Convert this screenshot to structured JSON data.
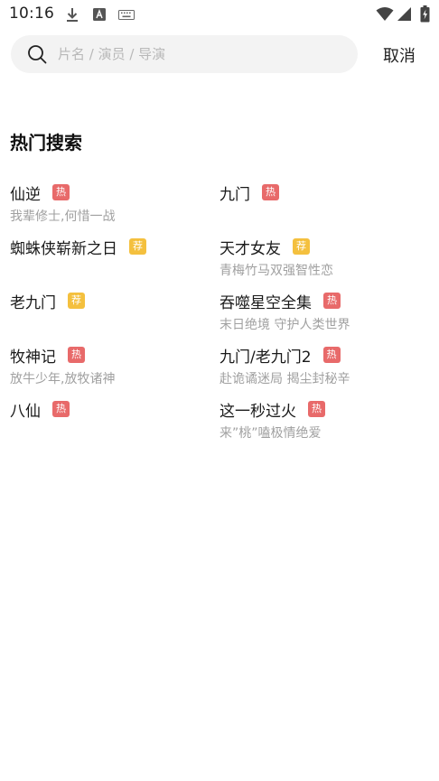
{
  "status_bar": {
    "time": "10:16"
  },
  "search": {
    "placeholder": "片名 / 演员 / 导演",
    "value": "",
    "cancel_label": "取消"
  },
  "hot_search": {
    "title": "热门搜索",
    "badge_colors": {
      "hot": "#e86a6a",
      "recommend": "#f4c03e"
    },
    "items": [
      {
        "title": "仙逆",
        "badge": "热",
        "badge_type": "hot",
        "subtitle": "我辈修士,何惜一战"
      },
      {
        "title": "九门",
        "badge": "热",
        "badge_type": "hot",
        "subtitle": ""
      },
      {
        "title": "蜘蛛侠崭新之日",
        "badge": "荐",
        "badge_type": "recommend",
        "subtitle": ""
      },
      {
        "title": "天才女友",
        "badge": "荐",
        "badge_type": "recommend",
        "subtitle": "青梅竹马双强智性恋"
      },
      {
        "title": "老九门",
        "badge": "荐",
        "badge_type": "recommend",
        "subtitle": ""
      },
      {
        "title": "吞噬星空全集",
        "badge": "热",
        "badge_type": "hot",
        "subtitle": "末日绝境 守护人类世界"
      },
      {
        "title": "牧神记",
        "badge": "热",
        "badge_type": "hot",
        "subtitle": "放牛少年,放牧诸神"
      },
      {
        "title": "九门/老九门2",
        "badge": "热",
        "badge_type": "hot",
        "subtitle": "赴诡谲迷局 揭尘封秘辛"
      },
      {
        "title": "八仙",
        "badge": "热",
        "badge_type": "hot",
        "subtitle": ""
      },
      {
        "title": "这一秒过火",
        "badge": "热",
        "badge_type": "hot",
        "subtitle": "来”桃”嗑极情绝爱"
      }
    ]
  }
}
